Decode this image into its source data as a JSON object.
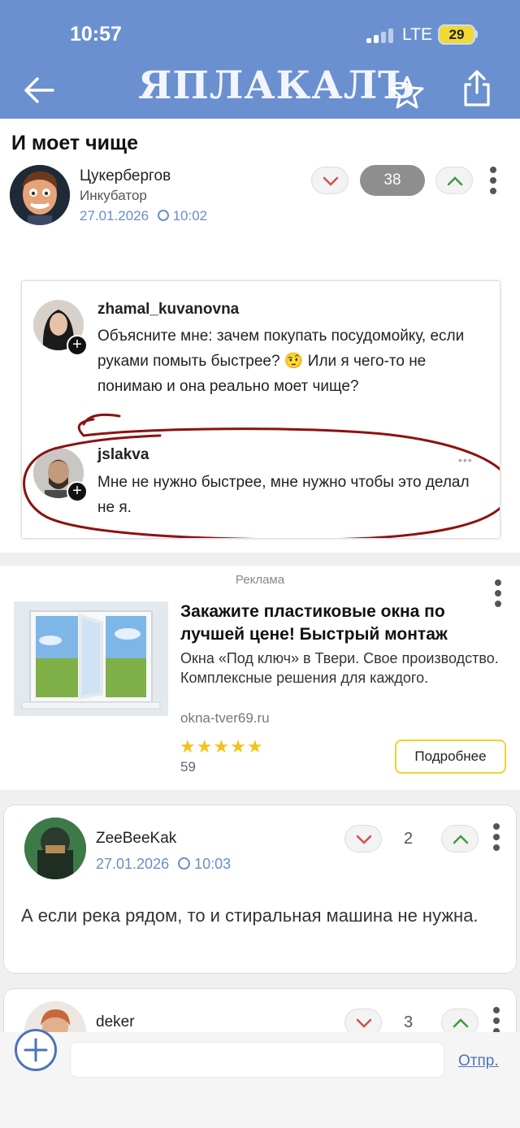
{
  "status": {
    "time": "10:57",
    "network": "LTE",
    "battery": "29"
  },
  "header": {
    "logo": "ЯПЛАКАЛЪ",
    "back_icon": "arrow-left-icon",
    "favorite_icon": "star-icon",
    "share_icon": "share-icon",
    "color": "#6a90cf"
  },
  "post": {
    "title": "И моет чище",
    "author": "Цукербергов",
    "rank": "Инкубатор",
    "date": "27.01.2026",
    "time": "10:02",
    "score": "38",
    "embedded": {
      "comment1": {
        "user": "zhamal_kuvanovna",
        "text": "Объясните мне: зачем покупать посудомойку, если руками помыть быстрее? 🤨 Или я чего-то не понимаю и она реально моет чище?"
      },
      "comment2": {
        "user": "jslakva",
        "text": "Мне не нужно быстрее, мне нужно чтобы это делал не я."
      }
    }
  },
  "ad": {
    "label": "Реклама",
    "title": "Закажите пластиковые окна по лучшей цене! Быстрый монтаж",
    "description": "Окна «Под ключ» в Твери. Свое производство. Комплексные решения для каждого.",
    "domain": "okna-tver69.ru",
    "stars": "★★★★★",
    "rating_count": "59",
    "button": "Подробнее"
  },
  "comments": [
    {
      "user": "ZeeBeeKak",
      "date": "27.01.2026",
      "time": "10:03",
      "score": "2",
      "text": "А если река рядом, то и стиральная машина не нужна."
    },
    {
      "user": "deker",
      "score": "3"
    }
  ],
  "composer": {
    "placeholder": "",
    "send": "Отпр."
  }
}
